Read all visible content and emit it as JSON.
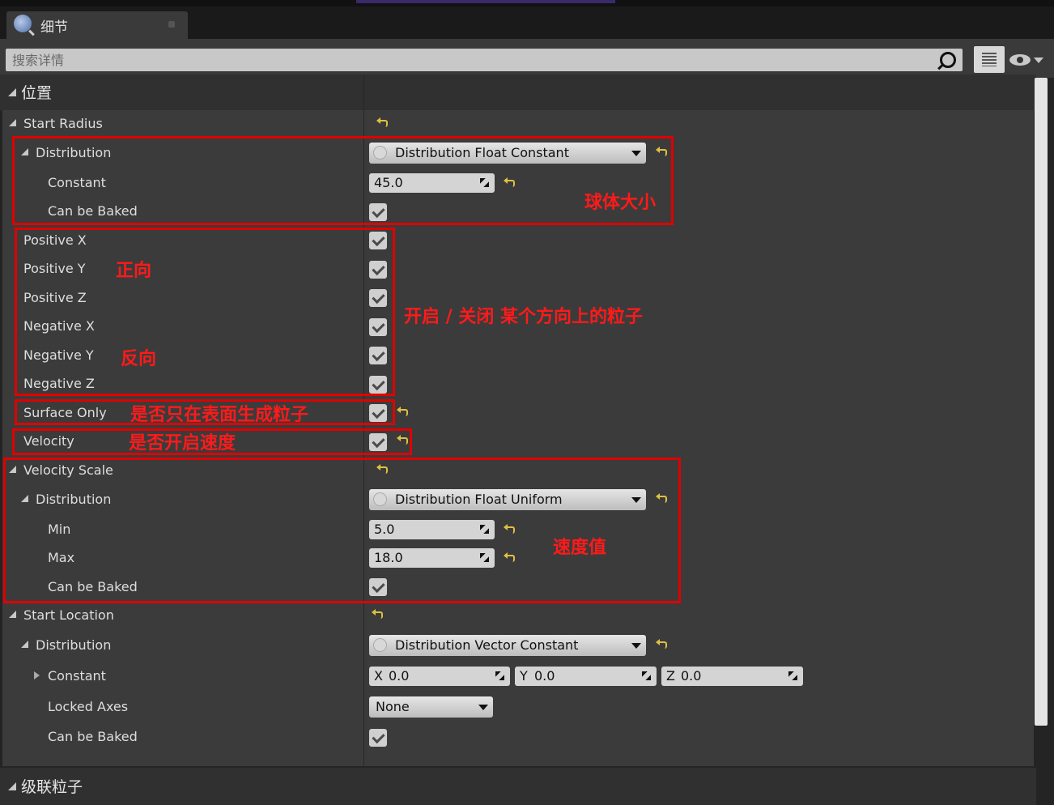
{
  "tab": {
    "title": "细节"
  },
  "search": {
    "placeholder": "搜索详情"
  },
  "sections": {
    "position": "位置",
    "cascade": "级联粒子"
  },
  "rows": {
    "start_radius": "Start Radius",
    "distribution": "Distribution",
    "constant": "Constant",
    "can_be_baked": "Can be Baked",
    "positive_x": "Positive X",
    "positive_y": "Positive Y",
    "positive_z": "Positive Z",
    "negative_x": "Negative X",
    "negative_y": "Negative Y",
    "negative_z": "Negative Z",
    "surface_only": "Surface Only",
    "velocity": "Velocity",
    "velocity_scale": "Velocity Scale",
    "min": "Min",
    "max": "Max",
    "start_location": "Start Location",
    "locked_axes": "Locked Axes"
  },
  "values": {
    "radius_distribution": "Distribution Float Constant",
    "radius_constant": "45.0",
    "velocity_distribution": "Distribution Float Uniform",
    "velocity_min": "5.0",
    "velocity_max": "18.0",
    "location_distribution": "Distribution Vector Constant",
    "loc_x_label": "X",
    "loc_x": "0.0",
    "loc_y_label": "Y",
    "loc_y": "0.0",
    "loc_z_label": "Z",
    "loc_z": "0.0",
    "locked_axes": "None"
  },
  "checkboxes": {
    "radius_can_be_baked": true,
    "positive_x": true,
    "positive_y": true,
    "positive_z": true,
    "negative_x": true,
    "negative_y": true,
    "negative_z": true,
    "surface_only": true,
    "velocity": true,
    "velocity_can_be_baked": true,
    "location_can_be_baked": true
  },
  "annotations": {
    "sphere_size": "球体大小",
    "positive": "正向",
    "toggle_direction": "开启 / 关闭 某个方向上的粒子",
    "negative": "反向",
    "surface_only": "是否只在表面生成粒子",
    "velocity_enabled": "是否开启速度",
    "velocity_value": "速度值"
  },
  "colors": {
    "annotation": "#ff1a1a",
    "reset_arrow": "#e0c040",
    "panel": "#3b3b3b"
  }
}
